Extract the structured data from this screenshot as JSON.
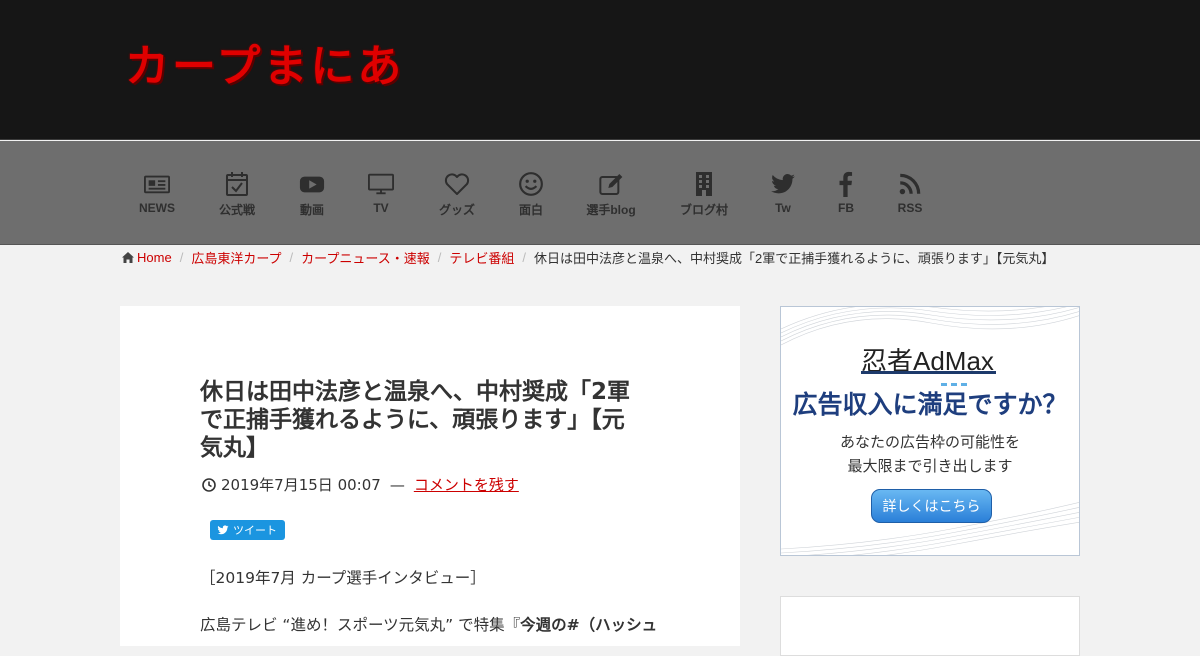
{
  "site": {
    "logo": "カープまにあ"
  },
  "nav": [
    {
      "label": "NEWS",
      "icon": "newspaper-icon"
    },
    {
      "label": "公式戦",
      "icon": "calendar-check-icon"
    },
    {
      "label": "動画",
      "icon": "youtube-icon"
    },
    {
      "label": "TV",
      "icon": "tv-icon"
    },
    {
      "label": "グッズ",
      "icon": "heart-icon"
    },
    {
      "label": "面白",
      "icon": "smile-icon"
    },
    {
      "label": "選手blog",
      "icon": "edit-icon"
    },
    {
      "label": "ブログ村",
      "icon": "building-icon"
    },
    {
      "label": "Tw",
      "icon": "twitter-icon"
    },
    {
      "label": "FB",
      "icon": "facebook-icon"
    },
    {
      "label": "RSS",
      "icon": "rss-icon"
    }
  ],
  "breadcrumb": {
    "home": "Home",
    "items": [
      "広島東洋カープ",
      "カープニュース・速報",
      "テレビ番組"
    ],
    "current": "休日は田中法彦と温泉へ、中村奨成「2軍で正捕手獲れるように、頑張ります」【元気丸】"
  },
  "post": {
    "title_lines": [
      "休日は田中法彦と温泉へ、中村奨成「2軍",
      "で正捕手獲れるように、頑張ります」【元",
      "気丸】"
    ],
    "date": "2019年7月15日 00:07",
    "separator": "—",
    "comment_link": "コメントを残す",
    "tweet_label": "ツイート",
    "body_1": "［2019年7月 カープ選手インタビュー］",
    "body_2_plain": "広島テレビ “進め！スポーツ元気丸” で特集『",
    "body_2_bold": "今週の#（ハッシュ"
  },
  "ad": {
    "logo": "忍者AdMax",
    "headline": "広告収入に満足ですか？",
    "sub_1": "あなたの広告枠の可能性を",
    "sub_2": "最大限まで引き出します",
    "button": "詳しくはこちら"
  },
  "colors": {
    "header_bg": "#161616",
    "nav_bg": "#6e6e6e",
    "logo_red": "#e00000",
    "link_red": "#cc0000",
    "ad_blue": "#1e3e7e"
  }
}
